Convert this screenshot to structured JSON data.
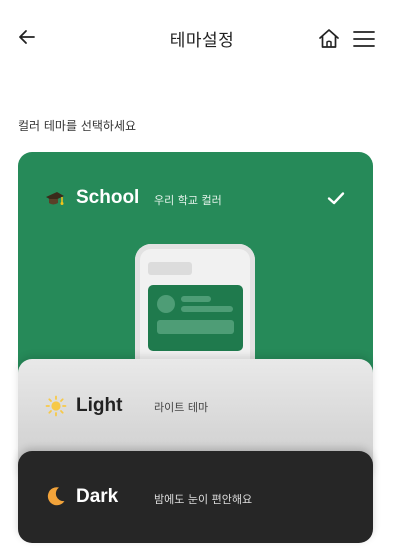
{
  "header": {
    "title": "테마설정",
    "back_icon": "arrow-left-icon",
    "home_icon": "home-icon",
    "menu_icon": "menu-icon"
  },
  "instruction": "컬러 테마를 선택하세요",
  "themes": [
    {
      "name": "School",
      "description": "우리 학교 컬러",
      "icon": "graduation-cap-icon",
      "selected": true,
      "color": "#268a59"
    },
    {
      "name": "Light",
      "description": "라이트 테마",
      "icon": "sun-icon",
      "selected": false,
      "color": "#dcdcdc"
    },
    {
      "name": "Dark",
      "description": "밤에도 눈이 편안해요",
      "icon": "moon-icon",
      "selected": false,
      "color": "#262626"
    }
  ],
  "colors": {
    "accent_green": "#268a59",
    "light_card": "#dcdcdc",
    "dark_card": "#262626",
    "moon_orange": "#f2a33a",
    "sun_yellow": "#f7c948"
  }
}
